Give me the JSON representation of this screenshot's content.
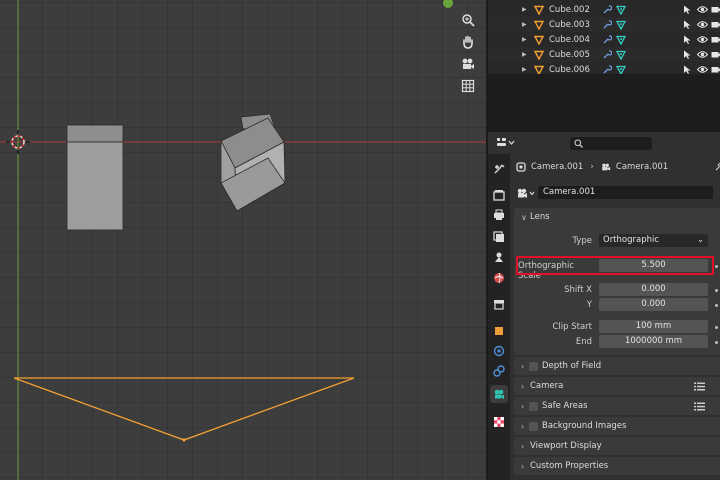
{
  "outliner": {
    "items": [
      {
        "label": "Cube.002"
      },
      {
        "label": "Cube.003"
      },
      {
        "label": "Cube.004"
      },
      {
        "label": "Cube.005"
      },
      {
        "label": "Cube.006"
      }
    ]
  },
  "properties": {
    "breadcrumb": {
      "object": "Camera.001",
      "data": "Camera.001"
    },
    "data_block_name": "Camera.001",
    "lens": {
      "title": "Lens",
      "type_label": "Type",
      "type_value": "Orthographic",
      "ortho_scale_label": "Orthographic Scale",
      "ortho_scale_value": "5.500",
      "shift_x_label": "Shift X",
      "shift_x_value": "0.000",
      "shift_y_label": "Y",
      "shift_y_value": "0.000",
      "clip_start_label": "Clip Start",
      "clip_start_value": "100 mm",
      "clip_end_label": "End",
      "clip_end_value": "1000000 mm"
    },
    "panels": [
      {
        "title": "Depth of Field"
      },
      {
        "title": "Camera"
      },
      {
        "title": "Safe Areas"
      },
      {
        "title": "Background Images"
      },
      {
        "title": "Viewport Display"
      },
      {
        "title": "Custom Properties"
      }
    ]
  },
  "colors": {
    "x_axis": "#b03a3a",
    "y_axis": "#6ca43c",
    "camera_selected": "#f5a033",
    "highlight": "#e0102a",
    "mesh_icon": "#36d1c4"
  }
}
